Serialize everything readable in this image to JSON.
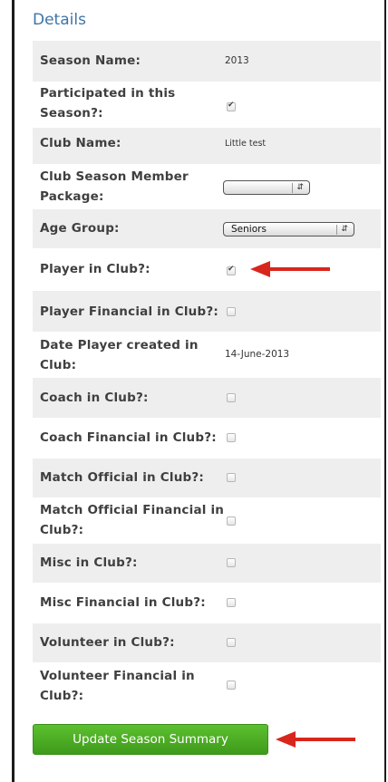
{
  "title": "Details",
  "rows": [
    {
      "label": "Season Name:",
      "value": "2013"
    },
    {
      "label": "Participated in this Season?:",
      "checked": true
    },
    {
      "label": "Club Name:",
      "value": "Little test"
    },
    {
      "label": "Club Season Member Package:",
      "select": ""
    },
    {
      "label": "Age Group:",
      "select": "Seniors"
    },
    {
      "label": "Player in Club?:",
      "checked": true
    },
    {
      "label": "Player Financial in Club?:",
      "checked": false
    },
    {
      "label": "Date Player created in Club:",
      "value": "14-June-2013"
    },
    {
      "label": "Coach in Club?:",
      "checked": false
    },
    {
      "label": "Coach Financial in Club?:",
      "checked": false
    },
    {
      "label": "Match Official in Club?:",
      "checked": false
    },
    {
      "label": "Match Official Financial in Club?:",
      "checked": false
    },
    {
      "label": "Misc in Club?:",
      "checked": false
    },
    {
      "label": "Misc Financial in Club?:",
      "checked": false
    },
    {
      "label": "Volunteer in Club?:",
      "checked": false
    },
    {
      "label": "Volunteer Financial in Club?:",
      "checked": false
    }
  ],
  "button": {
    "label": "Update Season Summary"
  },
  "colors": {
    "title": "#3f74a8",
    "button": "#4fae25",
    "arrow": "#d9261c",
    "row_shade": "#eeeeee"
  }
}
